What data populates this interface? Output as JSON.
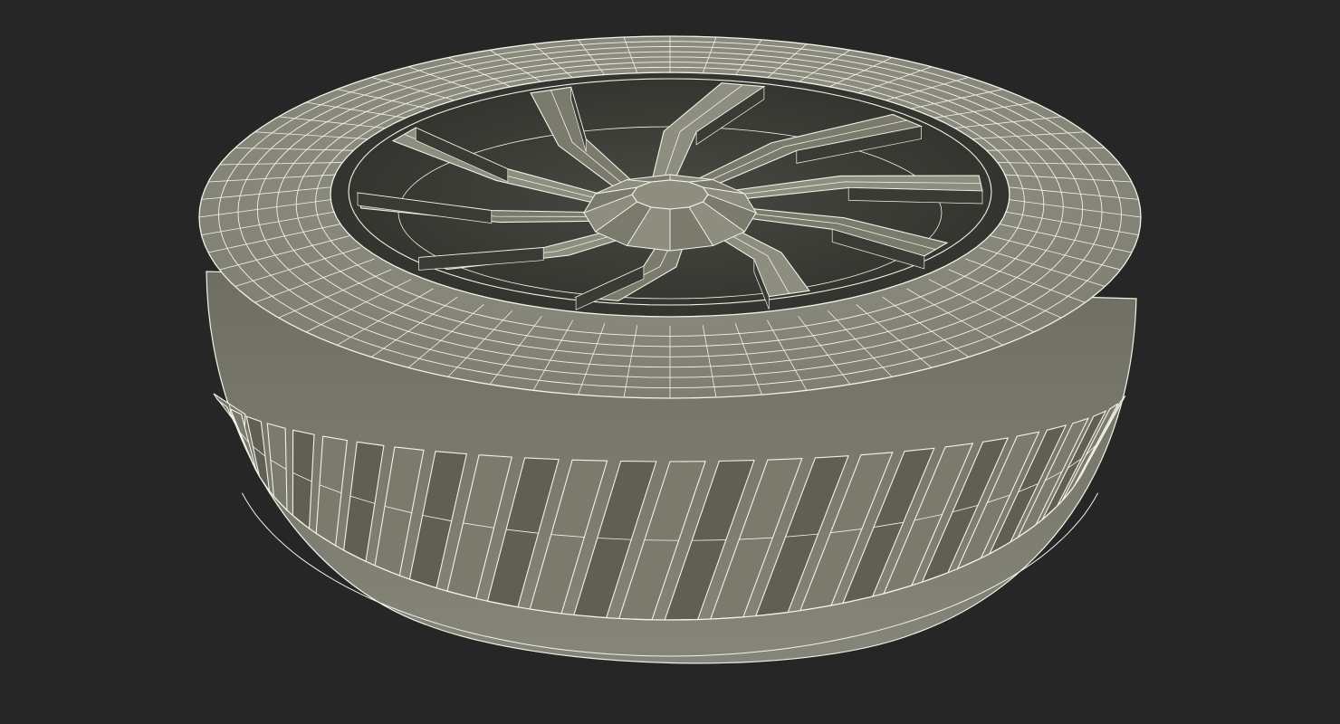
{
  "scene": {
    "subject": "wireframe-tire-with-rim",
    "colors": {
      "background": "#262626",
      "surface_light": "#8d8d80",
      "surface_mid": "#7a7a6d",
      "surface_dark": "#5f5f55",
      "shadow": "#3b3b36",
      "wire": "#f2f2e6"
    },
    "geometry_model": {
      "tread_segments": 28,
      "spokes": 10,
      "sidewall_rings": 6
    }
  }
}
